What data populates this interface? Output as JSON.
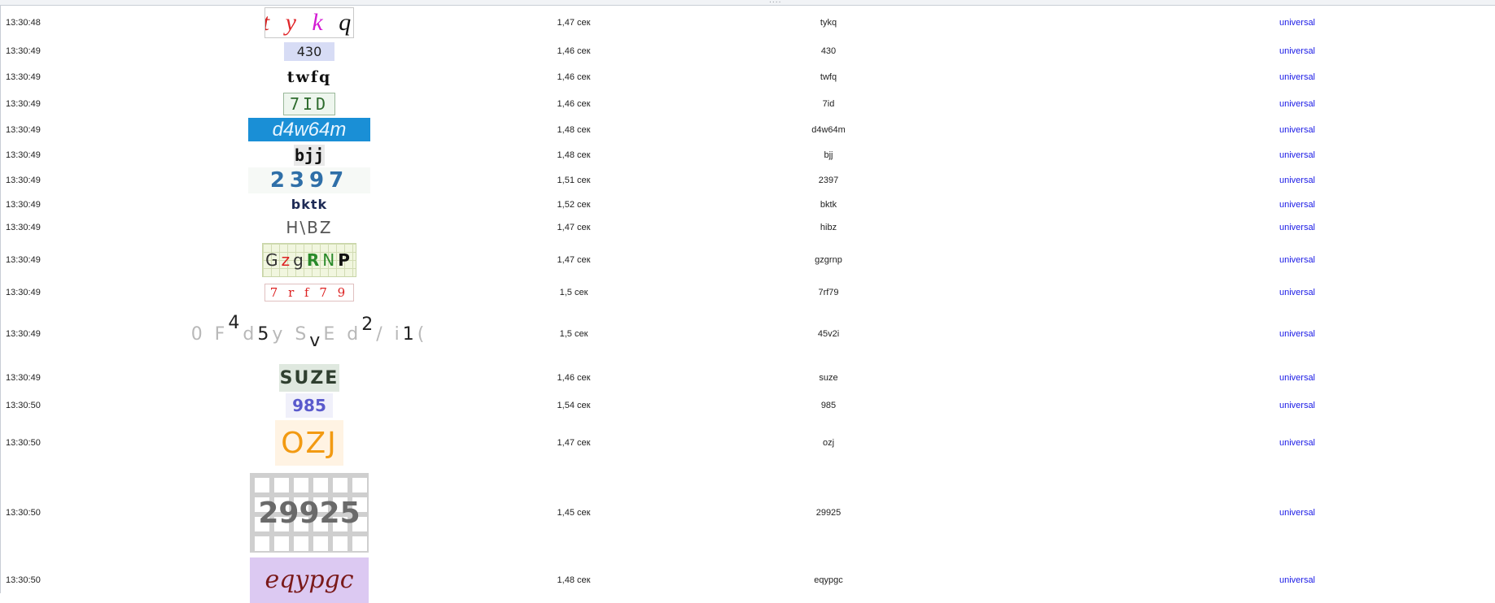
{
  "window": {
    "grip": "...."
  },
  "rows": [
    {
      "time": "13:30:48",
      "duration": "1,47 сек",
      "answer": "tykq",
      "module": "universal",
      "captcha": "t y k q"
    },
    {
      "time": "13:30:49",
      "duration": "1,46 сек",
      "answer": "430",
      "module": "universal",
      "captcha": "430"
    },
    {
      "time": "13:30:49",
      "duration": "1,46 сек",
      "answer": "twfq",
      "module": "universal",
      "captcha": "twfq"
    },
    {
      "time": "13:30:49",
      "duration": "1,46 сек",
      "answer": "7id",
      "module": "universal",
      "captcha": "7ID"
    },
    {
      "time": "13:30:49",
      "duration": "1,48 сек",
      "answer": "d4w64m",
      "module": "universal",
      "captcha": "d4w64m"
    },
    {
      "time": "13:30:49",
      "duration": "1,48 сек",
      "answer": "bjj",
      "module": "universal",
      "captcha": "bjj"
    },
    {
      "time": "13:30:49",
      "duration": "1,51 сек",
      "answer": "2397",
      "module": "universal",
      "captcha": "2397"
    },
    {
      "time": "13:30:49",
      "duration": "1,52 сек",
      "answer": "bktk",
      "module": "universal",
      "captcha": "bktk"
    },
    {
      "time": "13:30:49",
      "duration": "1,47 сек",
      "answer": "hibz",
      "module": "universal",
      "captcha": "H\\BZ"
    },
    {
      "time": "13:30:49",
      "duration": "1,47 сек",
      "answer": "gzgrnp",
      "module": "universal",
      "captcha": "GzgRNP"
    },
    {
      "time": "13:30:49",
      "duration": "1,5 сек",
      "answer": "7rf79",
      "module": "universal",
      "captcha": "7 r f 7 9"
    },
    {
      "time": "13:30:49",
      "duration": "1,5 сек",
      "answer": "45v2i",
      "module": "universal",
      "captcha": "0 F 4 d 5 y S v E d 2 / i 1 ("
    },
    {
      "time": "13:30:49",
      "duration": "1,46 сек",
      "answer": "suze",
      "module": "universal",
      "captcha": "SUZE"
    },
    {
      "time": "13:30:50",
      "duration": "1,54 сек",
      "answer": "985",
      "module": "universal",
      "captcha": "985"
    },
    {
      "time": "13:30:50",
      "duration": "1,47 сек",
      "answer": "ozj",
      "module": "universal",
      "captcha": "OZJ"
    },
    {
      "time": "13:30:50",
      "duration": "1,45 сек",
      "answer": "29925",
      "module": "universal",
      "captcha": "29925"
    },
    {
      "time": "13:30:50",
      "duration": "1,48 сек",
      "answer": "eqypgc",
      "module": "universal",
      "captcha": "eqypgc"
    }
  ]
}
